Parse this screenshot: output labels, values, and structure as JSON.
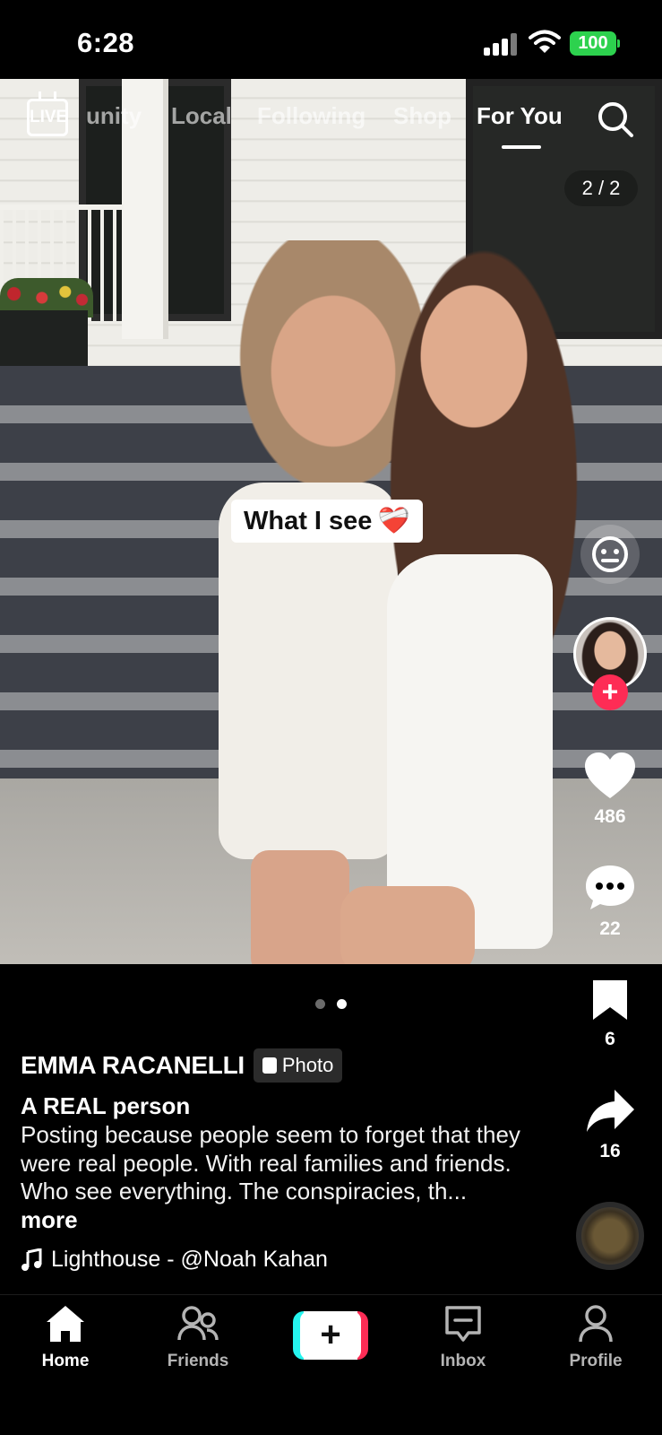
{
  "status_bar": {
    "time": "6:28",
    "battery": "100"
  },
  "top_nav": {
    "live_label": "LIVE",
    "tabs": [
      {
        "label": "unity",
        "active": false
      },
      {
        "label": "Local",
        "active": false
      },
      {
        "label": "Following",
        "active": false
      },
      {
        "label": "Shop",
        "active": false
      },
      {
        "label": "For You",
        "active": true
      }
    ]
  },
  "post": {
    "page_counter": "2 / 2",
    "sticker_text": "What I see",
    "sticker_emoji": "❤️‍🩹",
    "author": "EMMA RACANELLI",
    "type_badge": "Photo",
    "title": "A REAL person",
    "body": "Posting because people seem to forget that they were real people. With real families and friends. Who see everything. The conspiracies, th...",
    "more_label": "more",
    "sound": "Lighthouse - @Noah Kahan",
    "carousel": {
      "count": 2,
      "active_index": 1
    }
  },
  "actions": {
    "likes": "486",
    "comments": "22",
    "saves": "6",
    "shares": "16"
  },
  "bottom_nav": {
    "items": [
      {
        "label": "Home",
        "icon": "home-icon",
        "active": true
      },
      {
        "label": "Friends",
        "icon": "friends-icon",
        "active": false
      },
      {
        "label": "",
        "icon": "create-icon",
        "active": false
      },
      {
        "label": "Inbox",
        "icon": "inbox-icon",
        "active": false
      },
      {
        "label": "Profile",
        "icon": "profile-icon",
        "active": false
      }
    ]
  },
  "colors": {
    "accent": "#fe2c55",
    "accent_cyan": "#25f4ee",
    "battery": "#2dd24e"
  }
}
